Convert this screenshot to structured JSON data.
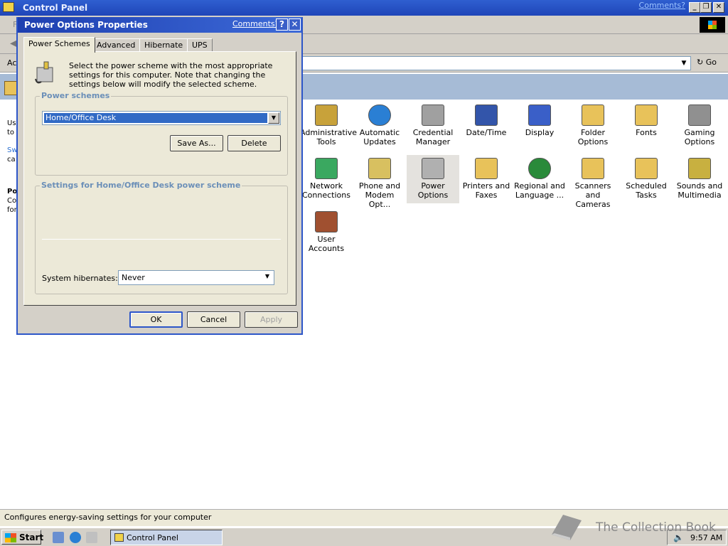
{
  "window": {
    "title": "Control Panel",
    "comments_link": "Comments?",
    "address_prefix": "Ac",
    "go_label": "Go",
    "status_text": "Configures energy-saving settings for your computer"
  },
  "left_pane_fragments": [
    "Us",
    "to",
    "Sw",
    "ca",
    "Po",
    "Co",
    "for"
  ],
  "icons": [
    {
      "name": "administrative-tools",
      "label1": "Administrative",
      "label2": "Tools",
      "color": "#c8a23a"
    },
    {
      "name": "automatic-updates",
      "label1": "Automatic",
      "label2": "Updates",
      "color": "#2a7fd4"
    },
    {
      "name": "credential-manager",
      "label1": "Credential",
      "label2": "Manager",
      "color": "#a0a0a0"
    },
    {
      "name": "date-time",
      "label1": "Date/Time",
      "label2": "",
      "color": "#3355aa"
    },
    {
      "name": "display",
      "label1": "Display",
      "label2": "",
      "color": "#3a5fc8"
    },
    {
      "name": "folder-options",
      "label1": "Folder Options",
      "label2": "",
      "color": "#e8c25a"
    },
    {
      "name": "fonts",
      "label1": "Fonts",
      "label2": "",
      "color": "#e8c25a"
    },
    {
      "name": "gaming-options",
      "label1": "Gaming",
      "label2": "Options",
      "color": "#909090"
    },
    {
      "name": "network-connections",
      "label1": "Network",
      "label2": "Connections",
      "color": "#3aa860"
    },
    {
      "name": "phone-modem-options",
      "label1": "Phone and",
      "label2": "Modem Opt...",
      "color": "#d8c060"
    },
    {
      "name": "power-options",
      "label1": "Power Options",
      "label2": "",
      "color": "#b0b0b0"
    },
    {
      "name": "printers-faxes",
      "label1": "Printers and",
      "label2": "Faxes",
      "color": "#e8c25a"
    },
    {
      "name": "regional-language",
      "label1": "Regional and",
      "label2": "Language ...",
      "color": "#2a8a3a"
    },
    {
      "name": "scanners-cameras",
      "label1": "Scanners and",
      "label2": "Cameras",
      "color": "#e8c25a"
    },
    {
      "name": "scheduled-tasks",
      "label1": "Scheduled",
      "label2": "Tasks",
      "color": "#e8c25a"
    },
    {
      "name": "sounds-multimedia",
      "label1": "Sounds and",
      "label2": "Multimedia",
      "color": "#c8b040"
    },
    {
      "name": "user-accounts",
      "label1": "User Accounts",
      "label2": "",
      "color": "#a05030"
    }
  ],
  "dialog": {
    "title": "Power Options Properties",
    "comments_link": "Comments?",
    "help_label": "?",
    "close_label": "✕",
    "tabs": [
      "Power Schemes",
      "Advanced",
      "Hibernate",
      "UPS"
    ],
    "intro": "Select the power scheme with the most appropriate settings for this computer. Note that changing the settings below will modify the selected scheme.",
    "schemes_legend": "Power schemes",
    "selected_scheme": "Home/Office Desk",
    "save_as": "Save As...",
    "delete": "Delete",
    "settings_legend": "Settings for Home/Office Desk power scheme",
    "hibernate_label": "System hibernates:",
    "hibernate_value": "Never",
    "ok": "OK",
    "cancel": "Cancel",
    "apply": "Apply"
  },
  "taskbar": {
    "start": "Start",
    "task_label": "Control Panel",
    "clock": "9:57 AM"
  },
  "watermark": "The Collection Book"
}
